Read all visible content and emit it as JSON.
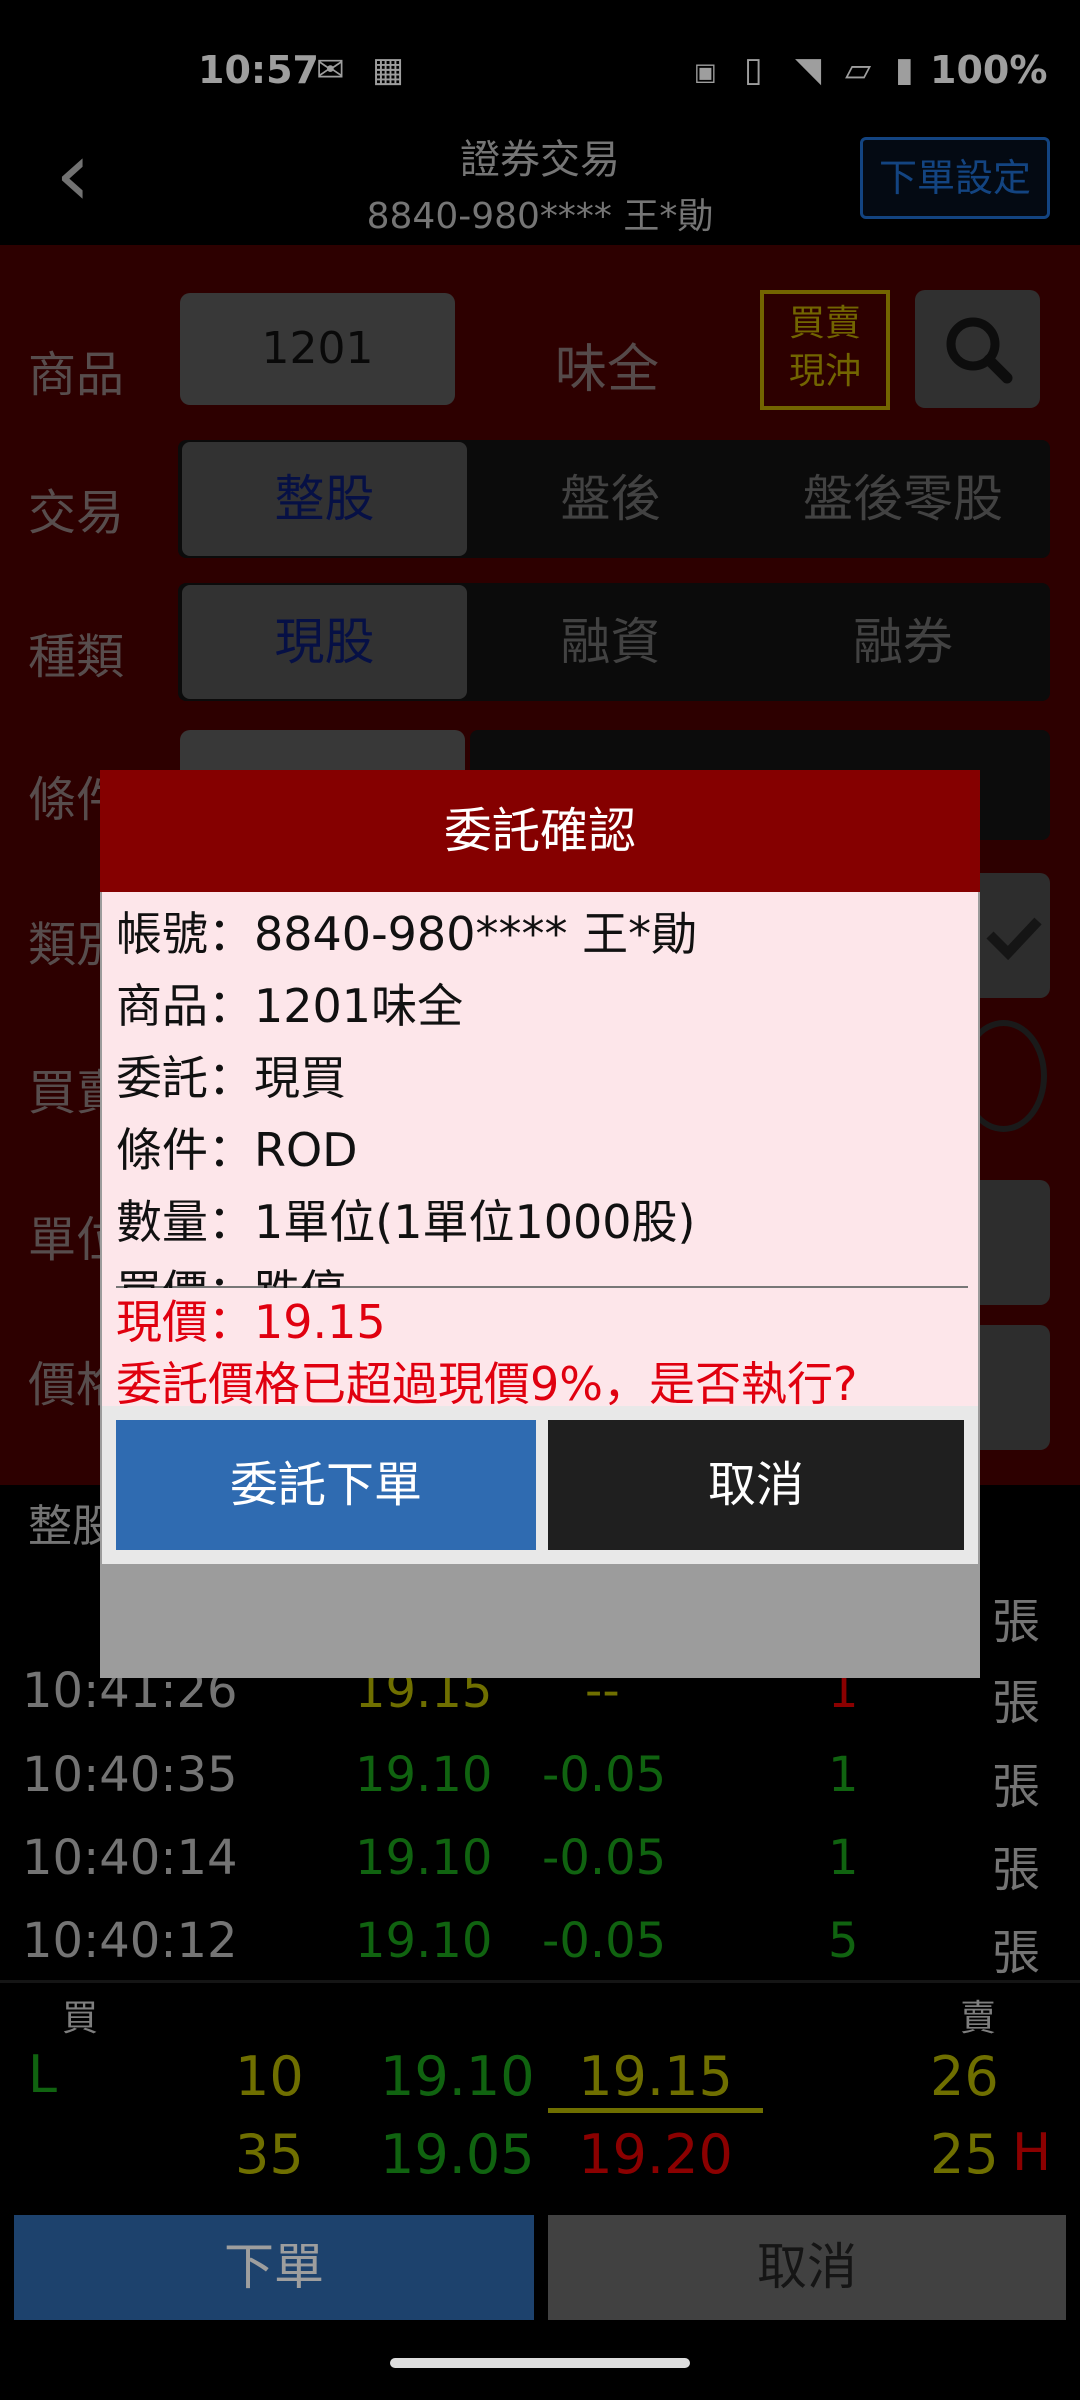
{
  "status_bar": {
    "time": "10:57",
    "battery": "100%"
  },
  "header": {
    "title": "證券交易",
    "account": "8840-980**** 王*勛",
    "settings_button": "下單設定"
  },
  "form": {
    "product_label": "商品",
    "product_code": "1201",
    "product_name": "味全",
    "buy_sell_badge_line1": "買賣",
    "buy_sell_badge_line2": "現沖",
    "trade_label": "交易",
    "trade_options": [
      "整股",
      "盤後",
      "盤後零股"
    ],
    "type_label": "種類",
    "type_options": [
      "現股",
      "融資",
      "融券"
    ],
    "condition_label": "條件",
    "category_label": "類別",
    "buysell_label": "買賣",
    "unit_label": "單位",
    "price_label": "價格"
  },
  "ticks": {
    "header": "整股",
    "unit": "張",
    "rows": [
      {
        "time": "10:41:26",
        "price": "19.15",
        "change": "--",
        "qty": "1"
      },
      {
        "time": "10:40:35",
        "price": "19.10",
        "change": "-0.05",
        "qty": "1"
      },
      {
        "time": "10:40:14",
        "price": "19.10",
        "change": "-0.05",
        "qty": "1"
      },
      {
        "time": "10:40:12",
        "price": "19.10",
        "change": "-0.05",
        "qty": "5"
      }
    ]
  },
  "book": {
    "buy_label": "買",
    "sell_label": "賣",
    "low_tag": "L",
    "high_tag": "H",
    "rows": [
      {
        "buy_qty": "10",
        "buy_price": "19.10",
        "sell_price": "19.15",
        "sell_qty": "26"
      },
      {
        "buy_qty": "35",
        "buy_price": "19.05",
        "sell_price": "19.20",
        "sell_qty": "25"
      }
    ]
  },
  "bottom": {
    "order_button": "下單",
    "cancel_button": "取消"
  },
  "dialog": {
    "title": "委託確認",
    "lines": [
      "帳號：8840-980**** 王*勛",
      "商品：1201味全",
      "委託：現買",
      "條件：ROD",
      "數量：1單位(1單位1000股)",
      "買價：跌停"
    ],
    "current_price": "現價：19.15",
    "warning": "委託價格已超過現價9%，是否執行?",
    "confirm_button": "委託下單",
    "cancel_button": "取消"
  },
  "colors": {
    "dialog_header": "#850000",
    "confirm_button": "#2f6bb1",
    "warning_text": "#e0000f"
  }
}
